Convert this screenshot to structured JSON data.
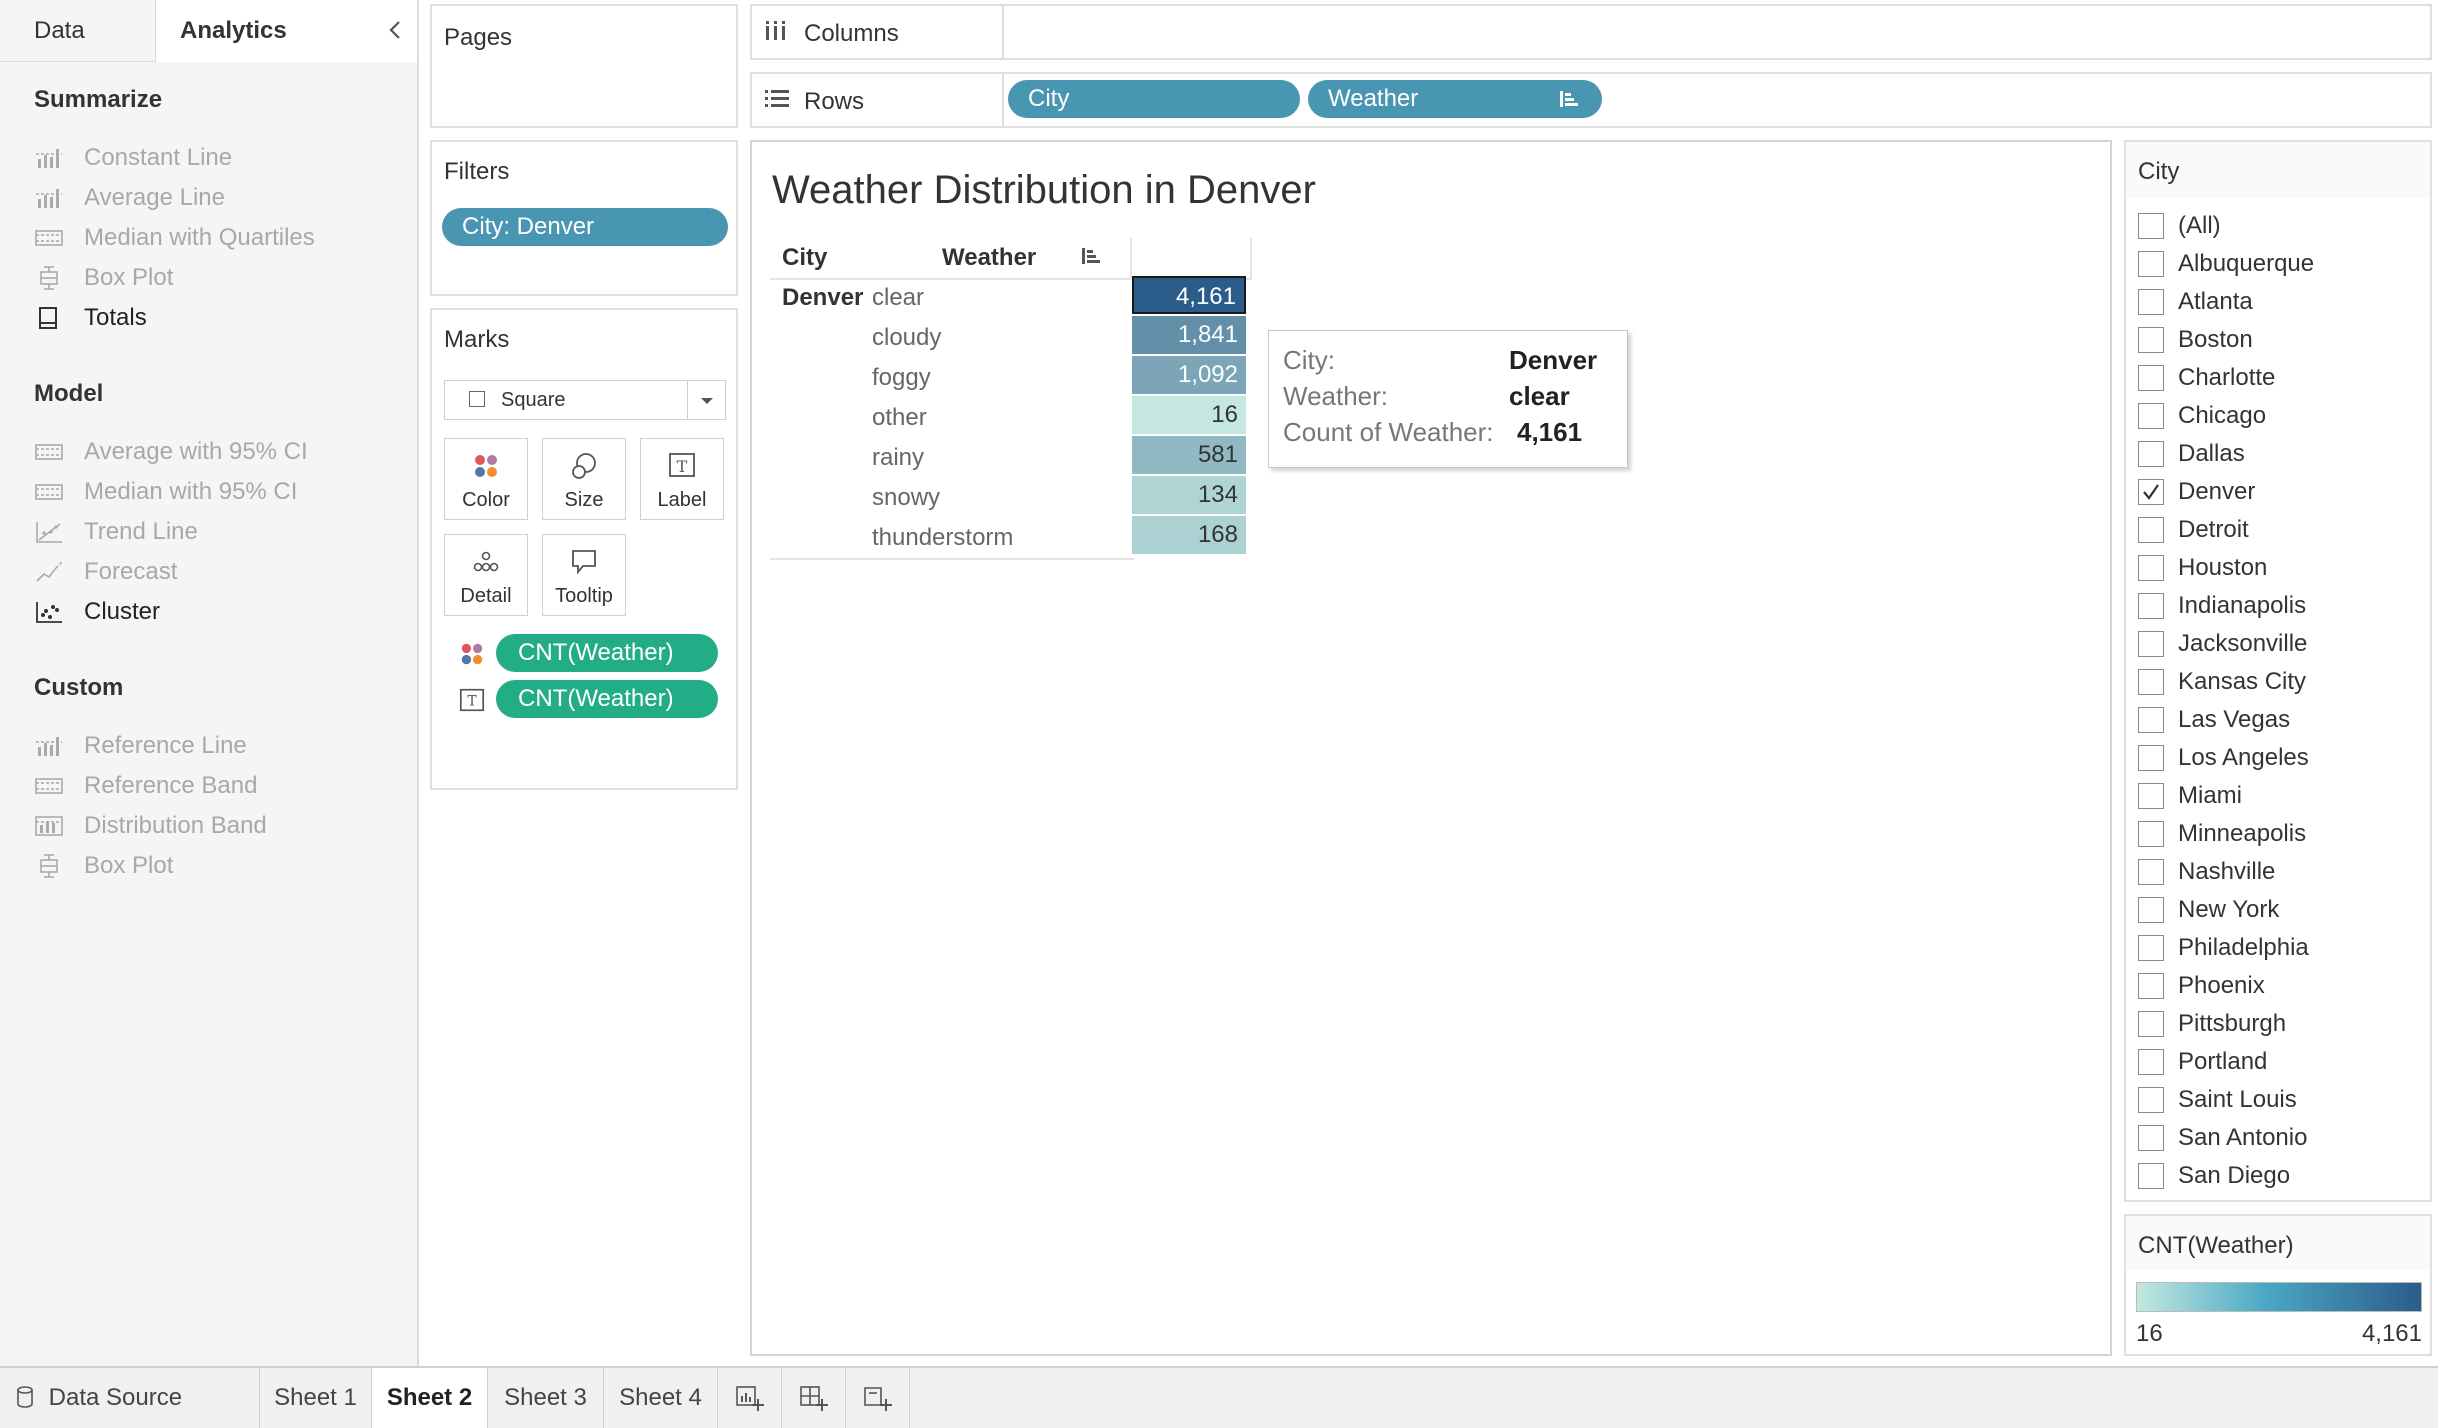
{
  "left_panel": {
    "tabs": [
      {
        "label": "Data"
      },
      {
        "label": "Analytics"
      }
    ],
    "sections": [
      {
        "title": "Summarize",
        "items": [
          {
            "label": "Constant Line",
            "icon": "bar-line-icon",
            "enabled": false
          },
          {
            "label": "Average Line",
            "icon": "bar-line-icon",
            "enabled": false
          },
          {
            "label": "Median with Quartiles",
            "icon": "band-icon",
            "enabled": false
          },
          {
            "label": "Box Plot",
            "icon": "box-plot-icon",
            "enabled": false
          },
          {
            "label": "Totals",
            "icon": "totals-icon",
            "enabled": true
          }
        ]
      },
      {
        "title": "Model",
        "items": [
          {
            "label": "Average with 95% CI",
            "icon": "band-icon",
            "enabled": false
          },
          {
            "label": "Median with 95% CI",
            "icon": "band-icon",
            "enabled": false
          },
          {
            "label": "Trend Line",
            "icon": "trend-icon",
            "enabled": false
          },
          {
            "label": "Forecast",
            "icon": "forecast-icon",
            "enabled": false
          },
          {
            "label": "Cluster",
            "icon": "cluster-icon",
            "enabled": true
          }
        ]
      },
      {
        "title": "Custom",
        "items": [
          {
            "label": "Reference Line",
            "icon": "bar-line-icon",
            "enabled": false
          },
          {
            "label": "Reference Band",
            "icon": "band-icon",
            "enabled": false
          },
          {
            "label": "Distribution Band",
            "icon": "distribution-icon",
            "enabled": false
          },
          {
            "label": "Box Plot",
            "icon": "box-plot-icon",
            "enabled": false
          }
        ]
      }
    ]
  },
  "pages": {
    "label": "Pages"
  },
  "filters": {
    "label": "Filters",
    "pills": [
      "City: Denver"
    ]
  },
  "marks": {
    "label": "Marks",
    "type": "Square",
    "buttons": [
      {
        "label": "Color"
      },
      {
        "label": "Size"
      },
      {
        "label": "Label"
      },
      {
        "label": "Detail"
      },
      {
        "label": "Tooltip"
      }
    ],
    "fields": [
      {
        "label": "CNT(Weather)",
        "icon": "color-dots-icon"
      },
      {
        "label": "CNT(Weather)",
        "icon": "label-t-icon"
      }
    ]
  },
  "columns": {
    "label": "Columns",
    "pills": []
  },
  "rows": {
    "label": "Rows",
    "pills": [
      "City",
      "Weather"
    ]
  },
  "view": {
    "title": "Weather Distribution in Denver",
    "headers": {
      "city": "City",
      "weather": "Weather"
    },
    "city": "Denver",
    "rows": [
      {
        "weather": "clear",
        "value": "4,161",
        "count": 4161
      },
      {
        "weather": "cloudy",
        "value": "1,841",
        "count": 1841
      },
      {
        "weather": "foggy",
        "value": "1,092",
        "count": 1092
      },
      {
        "weather": "other",
        "value": "16",
        "count": 16
      },
      {
        "weather": "rainy",
        "value": "581",
        "count": 581
      },
      {
        "weather": "snowy",
        "value": "134",
        "count": 134
      },
      {
        "weather": "thunderstorm",
        "value": "168",
        "count": 168
      }
    ],
    "color_min": "#c4e8e0",
    "color_max": "#2c5c8a"
  },
  "tooltip": {
    "rows": [
      {
        "label": "City:",
        "value": "Denver"
      },
      {
        "label": "Weather:",
        "value": "clear"
      },
      {
        "label": "Count of Weather:",
        "value": "4,161"
      }
    ]
  },
  "city_filter": {
    "title": "City",
    "options": [
      {
        "label": "(All)",
        "checked": false
      },
      {
        "label": "Albuquerque",
        "checked": false
      },
      {
        "label": "Atlanta",
        "checked": false
      },
      {
        "label": "Boston",
        "checked": false
      },
      {
        "label": "Charlotte",
        "checked": false
      },
      {
        "label": "Chicago",
        "checked": false
      },
      {
        "label": "Dallas",
        "checked": false
      },
      {
        "label": "Denver",
        "checked": true
      },
      {
        "label": "Detroit",
        "checked": false
      },
      {
        "label": "Houston",
        "checked": false
      },
      {
        "label": "Indianapolis",
        "checked": false
      },
      {
        "label": "Jacksonville",
        "checked": false
      },
      {
        "label": "Kansas City",
        "checked": false
      },
      {
        "label": "Las Vegas",
        "checked": false
      },
      {
        "label": "Los Angeles",
        "checked": false
      },
      {
        "label": "Miami",
        "checked": false
      },
      {
        "label": "Minneapolis",
        "checked": false
      },
      {
        "label": "Nashville",
        "checked": false
      },
      {
        "label": "New York",
        "checked": false
      },
      {
        "label": "Philadelphia",
        "checked": false
      },
      {
        "label": "Phoenix",
        "checked": false
      },
      {
        "label": "Pittsburgh",
        "checked": false
      },
      {
        "label": "Portland",
        "checked": false
      },
      {
        "label": "Saint Louis",
        "checked": false
      },
      {
        "label": "San Antonio",
        "checked": false
      },
      {
        "label": "San Diego",
        "checked": false
      }
    ]
  },
  "legend": {
    "title": "CNT(Weather)",
    "min": "16",
    "max": "4,161"
  },
  "bottom_tabs": {
    "data_source": "Data Source",
    "sheets": [
      {
        "label": "Sheet 1",
        "active": false
      },
      {
        "label": "Sheet 2",
        "active": true
      },
      {
        "label": "Sheet 3",
        "active": false
      },
      {
        "label": "Sheet 4",
        "active": false
      }
    ],
    "actions": [
      {
        "icon": "new-worksheet-icon"
      },
      {
        "icon": "new-dashboard-icon"
      },
      {
        "icon": "new-story-icon"
      }
    ]
  }
}
